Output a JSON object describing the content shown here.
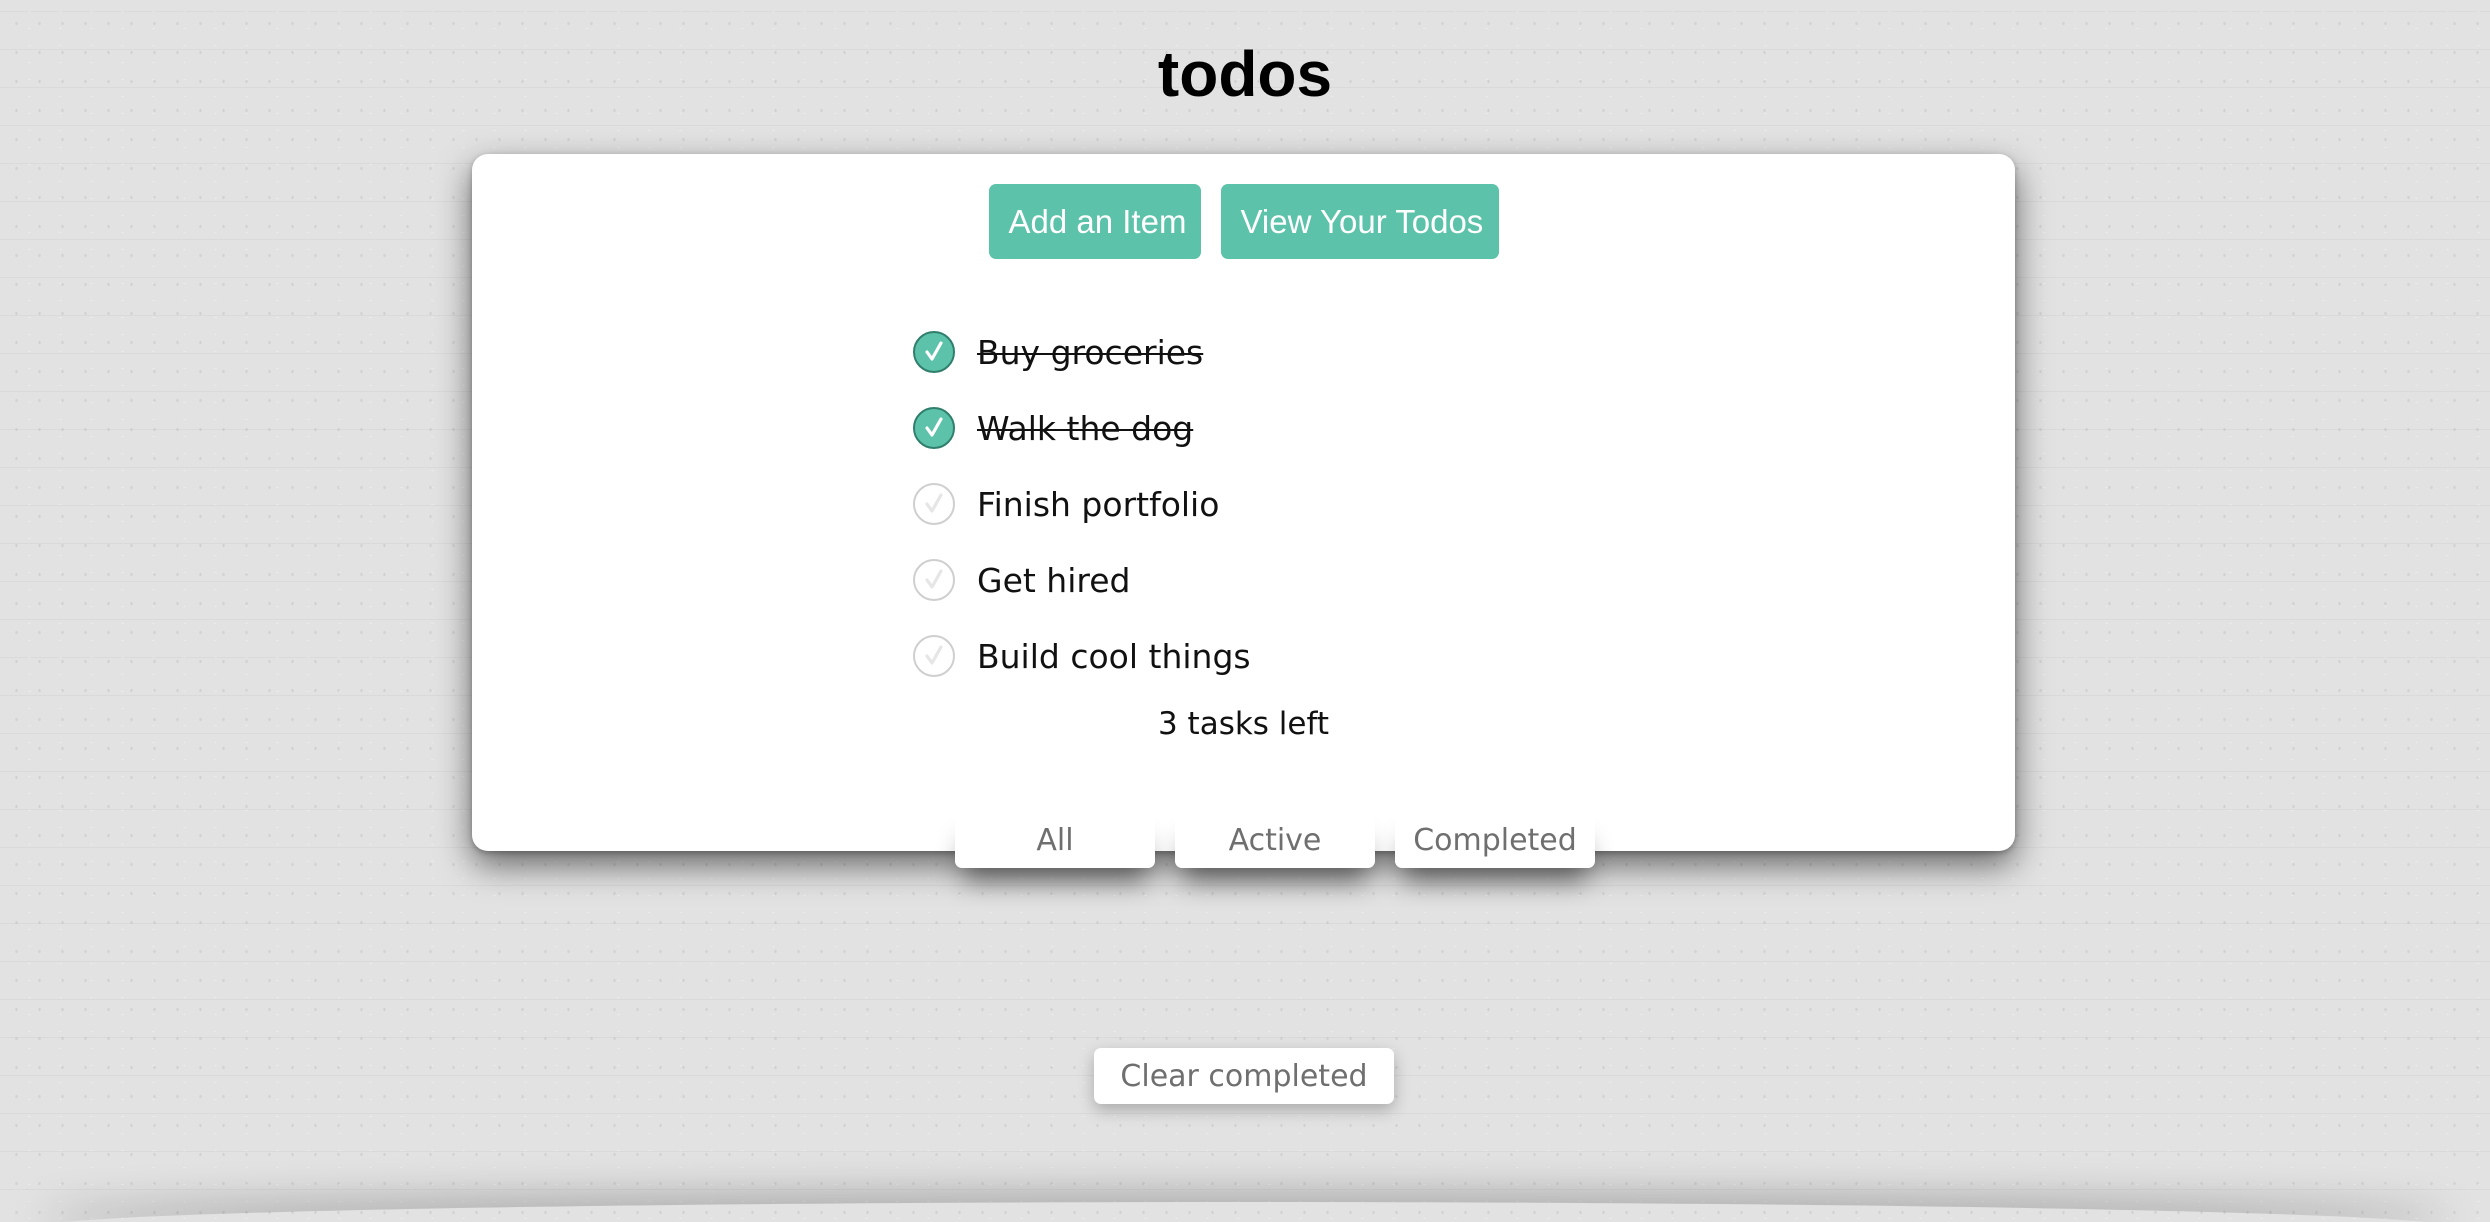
{
  "app": {
    "title": "todos"
  },
  "actions": {
    "add_label": "Add an Item",
    "view_label": "View Your Todos"
  },
  "todos": [
    {
      "text": "Buy groceries",
      "completed": true
    },
    {
      "text": "Walk the dog",
      "completed": true
    },
    {
      "text": "Finish portfolio",
      "completed": false
    },
    {
      "text": "Get hired",
      "completed": false
    },
    {
      "text": "Build cool things",
      "completed": false
    }
  ],
  "status": {
    "tasks_left": "3 tasks left"
  },
  "filters": [
    {
      "label": "All"
    },
    {
      "label": "Active"
    },
    {
      "label": "Completed"
    }
  ],
  "footer": {
    "clear_label": "Clear completed"
  },
  "colors": {
    "accent": "#5cc2a9",
    "check_border_done": "#2f7f6c",
    "check_border_open": "#cfcfcf"
  },
  "icons": {
    "checkmark": "checkmark-icon"
  }
}
